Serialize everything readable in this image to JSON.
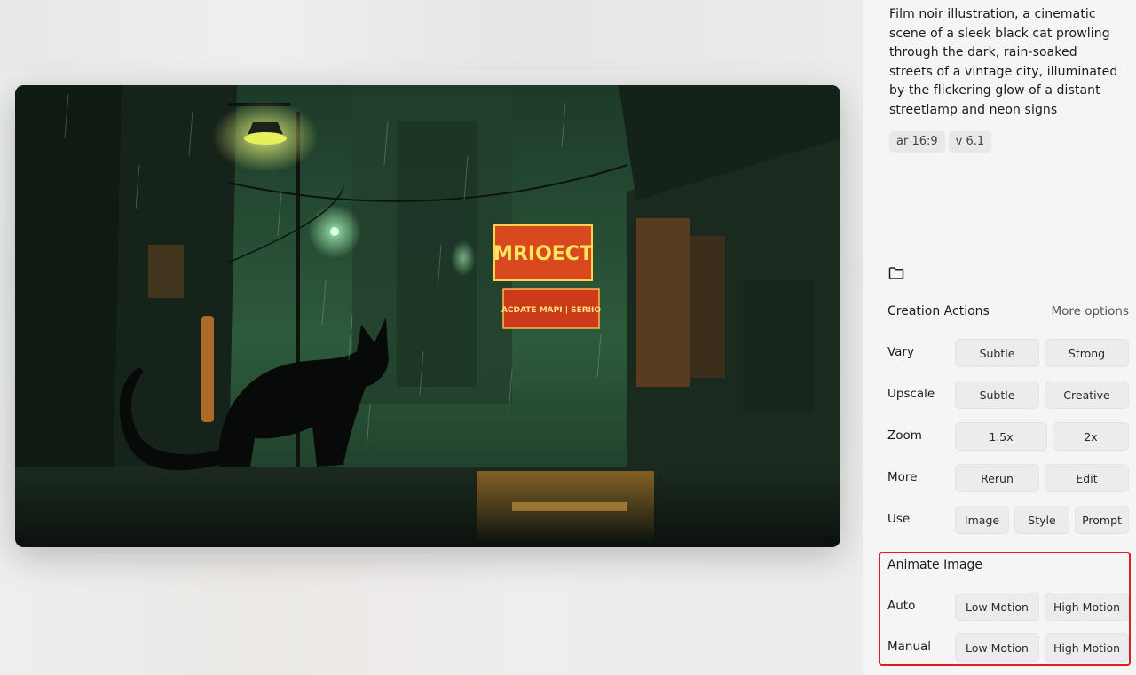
{
  "prompt_text": "Film noir illustration, a cinematic scene of a sleek black cat prowling through the dark, rain-soaked streets of a vintage city, illuminated by the flickering glow of a distant streetlamp and neon signs",
  "tags": [
    "ar 16:9",
    "v 6.1"
  ],
  "icons": {
    "folder": "folder-icon"
  },
  "creation_actions": {
    "title": "Creation Actions",
    "more_options": "More options",
    "rows": {
      "vary": {
        "label": "Vary",
        "buttons": [
          "Subtle",
          "Strong"
        ]
      },
      "upscale": {
        "label": "Upscale",
        "buttons": [
          "Subtle",
          "Creative"
        ]
      },
      "zoom": {
        "label": "Zoom",
        "buttons": [
          "1.5x",
          "2x"
        ]
      },
      "more": {
        "label": "More",
        "buttons": [
          "Rerun",
          "Edit"
        ]
      },
      "use": {
        "label": "Use",
        "buttons": [
          "Image",
          "Style",
          "Prompt"
        ]
      }
    }
  },
  "animate_image": {
    "title": "Animate Image",
    "rows": {
      "auto": {
        "label": "Auto",
        "buttons": [
          "Low Motion",
          "High Motion"
        ]
      },
      "manual": {
        "label": "Manual",
        "buttons": [
          "Low Motion",
          "High Motion"
        ]
      }
    }
  },
  "artwork": {
    "sign_top": "MRIOECT",
    "sign_bottom": "ACDATE MAPI | SERIIO"
  },
  "colors": {
    "highlight": "#e11b22",
    "button_bg": "#ececee",
    "panel_bg": "#f5f5f6"
  }
}
